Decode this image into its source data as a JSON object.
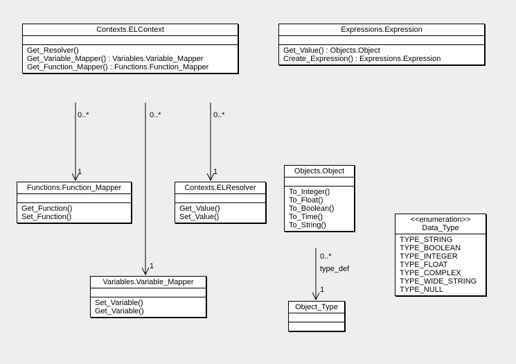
{
  "classes": {
    "elContext": {
      "name": "Contexts.ELContext",
      "ops": [
        "Get_Resolver()",
        "Get_Variable_Mapper() : Variables.Variable_Mapper",
        "Get_Function_Mapper() : Functions.Function_Mapper"
      ]
    },
    "expression": {
      "name": "Expressions.Expression",
      "ops": [
        "Get_Value() : Objects.Object",
        "Create_Expression() : Expressions.Expression"
      ]
    },
    "functionMapper": {
      "name": "Functions.Function_Mapper",
      "ops": [
        "Get_Function()",
        "Set_Function()"
      ]
    },
    "elResolver": {
      "name": "Contexts.ELResolver",
      "ops": [
        "Get_Value()",
        "Set_Value()"
      ]
    },
    "variableMapper": {
      "name": "Variables.Variable_Mapper",
      "ops": [
        "Set_Variable()",
        "Get_Variable()"
      ]
    },
    "objectsObject": {
      "name": "Objects.Object",
      "ops": [
        "To_Integer()",
        "To_Float()",
        "To_Boolean()",
        "To_Time()",
        "To_String()"
      ]
    },
    "objectType": {
      "name": "Object_Type"
    },
    "dataType": {
      "stereotype": "<<enumeration>>",
      "name": "Data_Type",
      "literals": [
        "TYPE_STRING",
        "TYPE_BOOLEAN",
        "TYPE_INTEGER",
        "TYPE_FLOAT",
        "TYPE_COMPLEX",
        "TYPE_WIDE_STRING",
        "TYPE_NULL"
      ]
    }
  },
  "assoc": {
    "ctxToFunc": {
      "near": "0..*",
      "far": "1"
    },
    "ctxToVar": {
      "near": "0..*",
      "far": "1"
    },
    "ctxToRes": {
      "near": "0..*",
      "far": "1"
    },
    "objToType": {
      "near": "0..*",
      "label": "type_def",
      "far": "1"
    }
  }
}
